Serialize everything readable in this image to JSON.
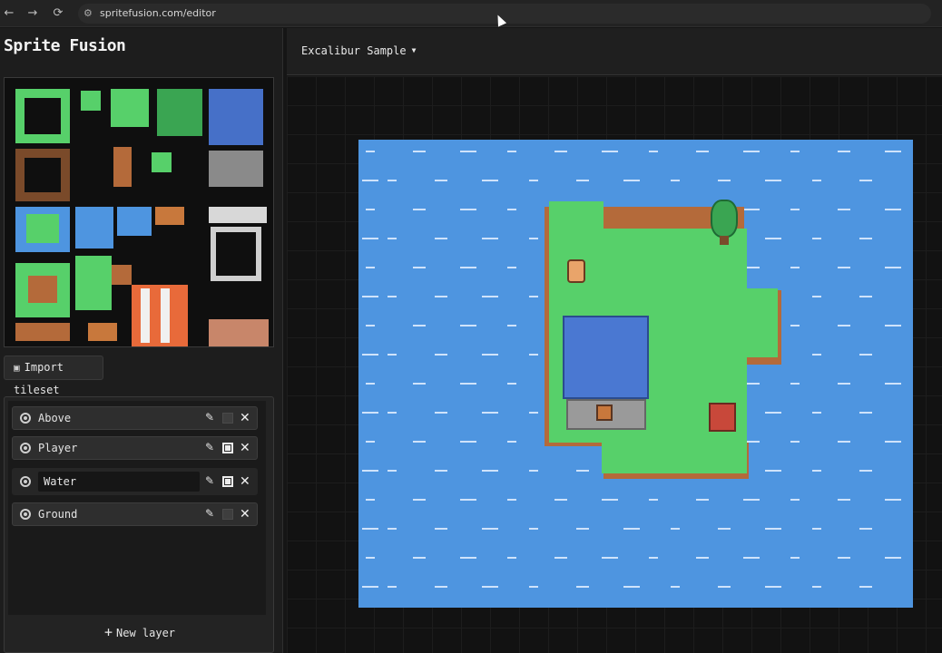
{
  "browser": {
    "url": "spritefusion.com/editor",
    "back_icon": "←",
    "forward_icon": "→",
    "reload_icon": "⟳",
    "site_icon": "⚙"
  },
  "app": {
    "title": "Sprite Fusion",
    "import_label": "Import tileset",
    "import_icon": "▣",
    "new_layer_label": "New layer",
    "new_layer_icon": "+"
  },
  "layers": [
    {
      "name": "Above",
      "visible": true,
      "selected_box": false
    },
    {
      "name": "Player",
      "visible": true,
      "selected_box": true
    },
    {
      "name": "Water",
      "visible": true,
      "selected_box": true,
      "editing": true
    },
    {
      "name": "Ground",
      "visible": true,
      "selected_box": false
    }
  ],
  "icons": {
    "edit": "✎",
    "delete": "✕"
  },
  "project": {
    "name": "Excalibur Sample",
    "caret": "▼"
  },
  "colors": {
    "water": "#4e95e0",
    "grass": "#57d06a",
    "shore": "#b46a3a"
  }
}
